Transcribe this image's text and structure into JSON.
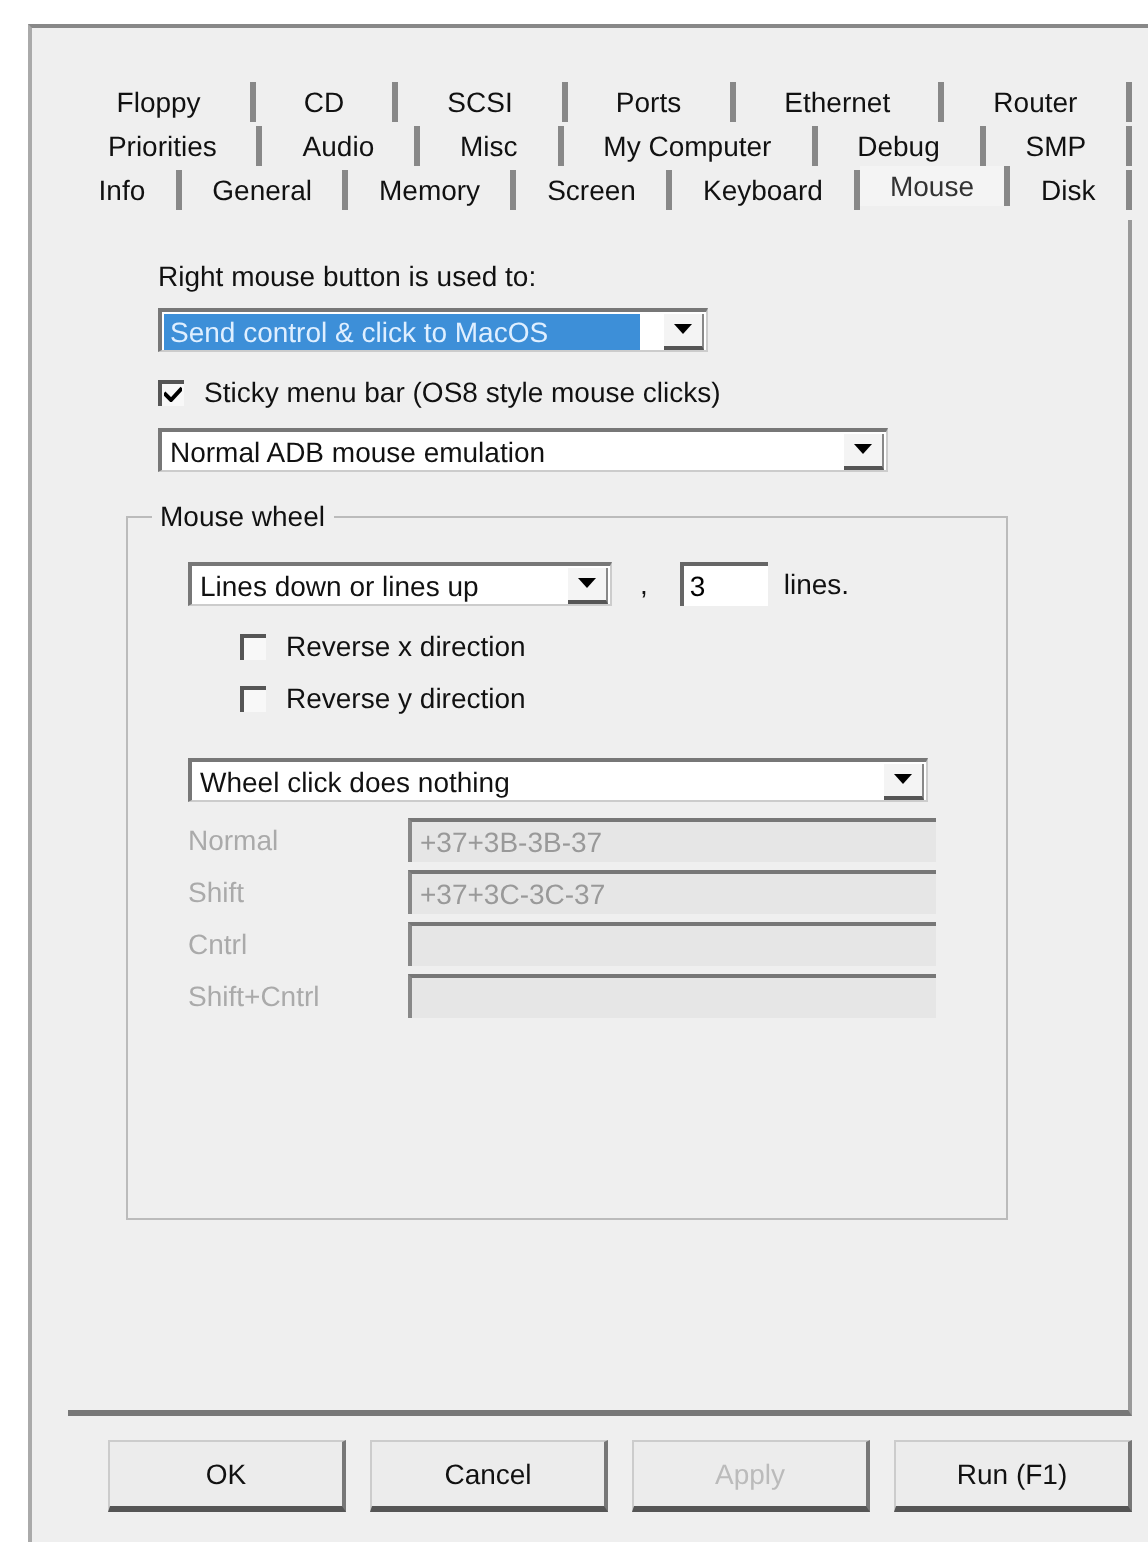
{
  "tab_rows": [
    [
      {
        "label": "Floppy",
        "selected": false
      },
      {
        "label": "CD",
        "selected": false
      },
      {
        "label": "SCSI",
        "selected": false
      },
      {
        "label": "Ports",
        "selected": false
      },
      {
        "label": "Ethernet",
        "selected": false
      },
      {
        "label": "Router",
        "selected": false
      }
    ],
    [
      {
        "label": "Priorities",
        "selected": false
      },
      {
        "label": "Audio",
        "selected": false
      },
      {
        "label": "Misc",
        "selected": false
      },
      {
        "label": "My Computer",
        "selected": false
      },
      {
        "label": "Debug",
        "selected": false
      },
      {
        "label": "SMP",
        "selected": false
      }
    ],
    [
      {
        "label": "Info",
        "selected": false
      },
      {
        "label": "General",
        "selected": false
      },
      {
        "label": "Memory",
        "selected": false
      },
      {
        "label": "Screen",
        "selected": false
      },
      {
        "label": "Keyboard",
        "selected": false
      },
      {
        "label": "Mouse",
        "selected": true
      },
      {
        "label": "Disk",
        "selected": false
      }
    ]
  ],
  "right_button": {
    "label": "Right mouse button is used to:",
    "value": "Send control & click to MacOS",
    "focused": true
  },
  "sticky_menu": {
    "label": "Sticky menu bar (OS8 style mouse clicks)",
    "checked": true
  },
  "emulation": {
    "value": "Normal ADB mouse emulation"
  },
  "mouse_wheel": {
    "title": "Mouse wheel",
    "mode": {
      "value": "Lines down or lines up"
    },
    "separator": ",",
    "lines": {
      "value": "3"
    },
    "lines_label": "lines.",
    "options": [
      {
        "label": "Reverse x direction",
        "checked": false
      },
      {
        "label": "Reverse y direction",
        "checked": false
      }
    ],
    "click": {
      "value": "Wheel click does nothing"
    },
    "keys": [
      {
        "label": "Normal",
        "value": "+37+3B-3B-37",
        "disabled": true
      },
      {
        "label": "Shift",
        "value": "+37+3C-3C-37",
        "disabled": true
      },
      {
        "label": "Cntrl",
        "disabled": true
      },
      {
        "label": "Shift+Cntrl",
        "disabled": true
      }
    ]
  },
  "buttons": [
    {
      "label": "OK",
      "disabled": false
    },
    {
      "label": "Cancel",
      "disabled": false
    },
    {
      "label": "Apply",
      "disabled": true
    },
    {
      "label": "Run (F1)",
      "disabled": false
    }
  ]
}
